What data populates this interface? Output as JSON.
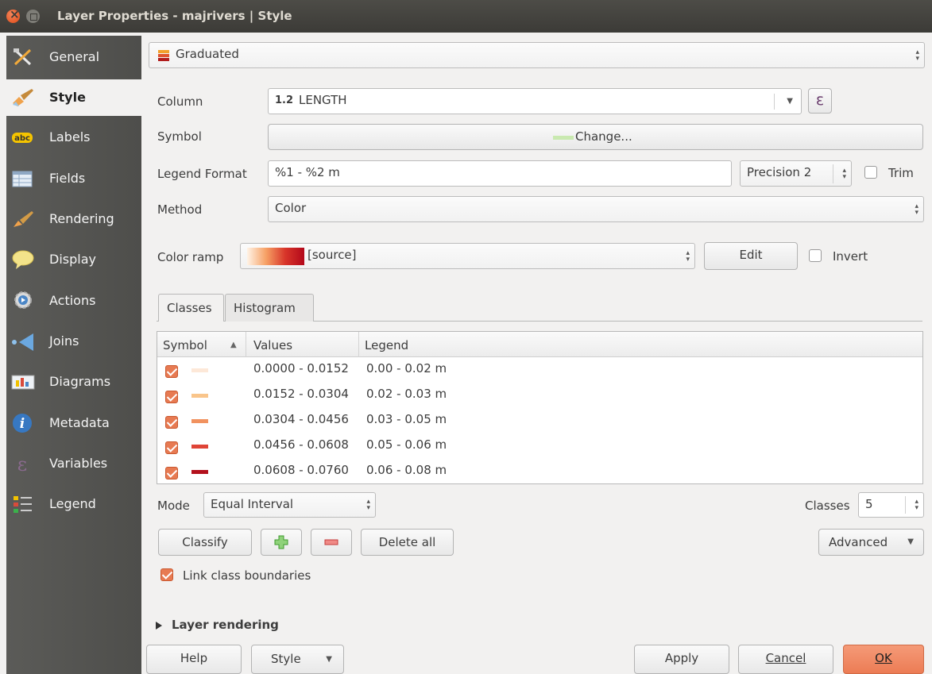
{
  "window": {
    "title": "Layer Properties - majrivers | Style"
  },
  "sidebar": {
    "items": [
      {
        "label": "General",
        "icon": "general-tools-icon"
      },
      {
        "label": "Style",
        "icon": "style-brush-icon"
      },
      {
        "label": "Labels",
        "icon": "labels-abc-icon"
      },
      {
        "label": "Fields",
        "icon": "fields-table-icon"
      },
      {
        "label": "Rendering",
        "icon": "rendering-brush-icon"
      },
      {
        "label": "Display",
        "icon": "display-bubble-icon"
      },
      {
        "label": "Actions",
        "icon": "actions-gear-icon"
      },
      {
        "label": "Joins",
        "icon": "joins-icon"
      },
      {
        "label": "Diagrams",
        "icon": "diagrams-icon"
      },
      {
        "label": "Metadata",
        "icon": "metadata-info-icon"
      },
      {
        "label": "Variables",
        "icon": "variables-epsilon-icon"
      },
      {
        "label": "Legend",
        "icon": "legend-icon"
      }
    ],
    "active": "Style"
  },
  "renderer": {
    "value": "Graduated"
  },
  "form": {
    "column_label": "Column",
    "column_type": "1.2",
    "column_value": "LENGTH",
    "expr_button": "ε",
    "symbol_label": "Symbol",
    "symbol_button": "Change...",
    "legend_format_label": "Legend Format",
    "legend_format_value": "%1 - %2 m",
    "precision_value": "Precision 2",
    "trim_label": "Trim",
    "method_label": "Method",
    "method_value": "Color",
    "color_ramp_label": "Color ramp",
    "color_ramp_value": "[source]",
    "edit_button": "Edit",
    "invert_label": "Invert"
  },
  "tabs": [
    {
      "label": "Classes"
    },
    {
      "label": "Histogram"
    }
  ],
  "table": {
    "headers": {
      "symbol": "Symbol",
      "sort_arrow": "▲",
      "values": "Values",
      "legend": "Legend"
    },
    "rows": [
      {
        "values": "0.0000 - 0.0152",
        "legend": "0.00 - 0.02 m",
        "color": "#fde8d8"
      },
      {
        "values": "0.0152 - 0.0304",
        "legend": "0.02 - 0.03 m",
        "color": "#f9c58b"
      },
      {
        "values": "0.0304 - 0.0456",
        "legend": "0.03 - 0.05 m",
        "color": "#f1925f"
      },
      {
        "values": "0.0456 - 0.0608",
        "legend": "0.05 - 0.06 m",
        "color": "#df4437"
      },
      {
        "values": "0.0608 - 0.0760",
        "legend": "0.06 - 0.08 m",
        "color": "#b3111d"
      }
    ]
  },
  "classification": {
    "mode_label": "Mode",
    "mode_value": "Equal Interval",
    "classes_label": "Classes",
    "classes_value": "5",
    "classify_button": "Classify",
    "delete_all_button": "Delete all",
    "advanced_button": "Advanced",
    "link_label": "Link class boundaries"
  },
  "layer_rendering": {
    "label": "Layer rendering"
  },
  "footer": {
    "help": "Help",
    "style": "Style",
    "apply": "Apply",
    "cancel": "Cancel",
    "ok": "OK"
  },
  "colors": {
    "accent": "#e77a52",
    "ok_button": "#f18a66",
    "sidebar": "#555553"
  }
}
